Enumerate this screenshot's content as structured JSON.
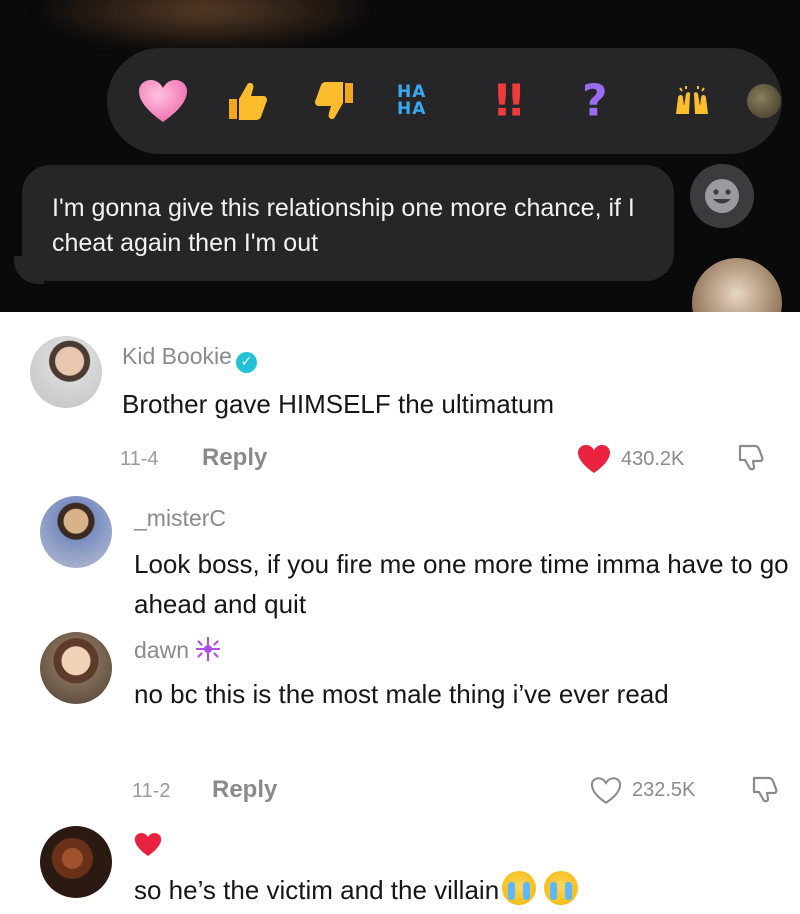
{
  "chat": {
    "reactions": [
      "heart",
      "thumbs-up",
      "thumbs-down",
      "HA HA",
      "!!",
      "?",
      "raised-hands"
    ],
    "haha_line1": "HA",
    "haha_line2": "HA",
    "exclaim": "!!",
    "question": "?",
    "message": "I'm gonna give this relationship one more chance, if I cheat again then I'm out",
    "colors": {
      "background": "#0a0a0a",
      "bubble": "#262628",
      "text": "#f2f2f2"
    }
  },
  "comments": [
    {
      "username": "Kid Bookie",
      "verified": true,
      "text": "Brother gave HIMSELF the ultimatum",
      "date": "11-4",
      "reply_label": "Reply",
      "likes": "430.2K",
      "liked": true
    },
    {
      "username": "_misterC",
      "text": "Look boss, if you fire me one more time imma have to go ahead and quit"
    },
    {
      "username": "dawn",
      "text": "no bc this is the most male thing i’ve ever read",
      "date": "11-2",
      "reply_label": "Reply",
      "likes": "232.5K",
      "liked": false
    },
    {
      "text": "so he’s the victim and the villain"
    }
  ],
  "colors": {
    "liked_heart": "#e8223f",
    "verified": "#22c1d6",
    "muted": "#8a8a8a"
  }
}
